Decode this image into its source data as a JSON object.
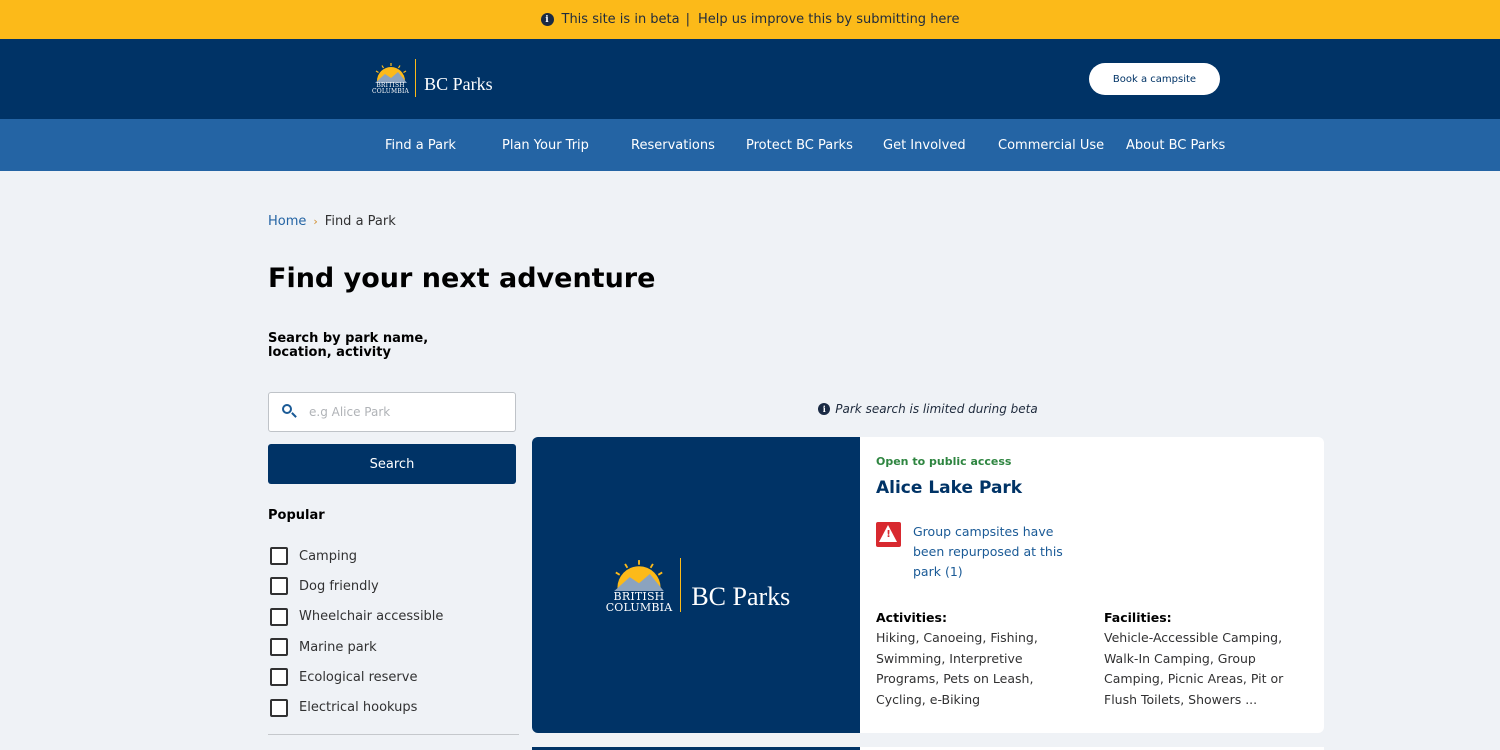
{
  "beta_banner": {
    "text": "This site is in beta",
    "separator": "|",
    "link": "Help us improve this by submitting here"
  },
  "header": {
    "logo_bc_line1": "BRITISH",
    "logo_bc_line2": "COLUMBIA",
    "logo_parks": "BC Parks",
    "book_button": "Book a campsite"
  },
  "nav": {
    "items": [
      {
        "label": "Find a Park"
      },
      {
        "label": "Plan Your Trip"
      },
      {
        "label": "Reservations"
      },
      {
        "label": "Protect BC Parks"
      },
      {
        "label": "Get Involved"
      },
      {
        "label": "Commercial Use"
      },
      {
        "label": "About BC Parks"
      }
    ]
  },
  "breadcrumb": {
    "home": "Home",
    "separator": "›",
    "current": "Find a Park"
  },
  "page_title": "Find your next adventure",
  "search": {
    "label": "Search by park name, location, activity",
    "placeholder": "e.g Alice Park",
    "value": "",
    "button": "Search"
  },
  "filters": {
    "popular_title": "Popular",
    "items": [
      {
        "label": "Camping",
        "checked": false
      },
      {
        "label": "Dog friendly",
        "checked": false
      },
      {
        "label": "Wheelchair accessible",
        "checked": false
      },
      {
        "label": "Marine park",
        "checked": false
      },
      {
        "label": "Ecological reserve",
        "checked": false
      },
      {
        "label": "Electrical hookups",
        "checked": false
      }
    ]
  },
  "results": {
    "beta_note": "Park search is limited during beta",
    "parks": [
      {
        "status": "Open to public access",
        "name": "Alice Lake Park",
        "alert": "Group campsites have been repurposed at this park (1)",
        "activities_title": "Activities:",
        "activities": "Hiking, Canoeing, Fishing, Swimming, Interpretive Programs, Pets on Leash, Cycling, e-Biking",
        "facilities_title": "Facilities:",
        "facilities": "Vehicle-Accessible Camping, Walk-In Camping, Group Camping, Picnic Areas, Pit or Flush Toilets, Showers ..."
      }
    ]
  },
  "colors": {
    "banner": "#fcba19",
    "header": "#003366",
    "nav": "#2464a4",
    "open_status": "#2e8540",
    "alert": "#d8292f"
  }
}
